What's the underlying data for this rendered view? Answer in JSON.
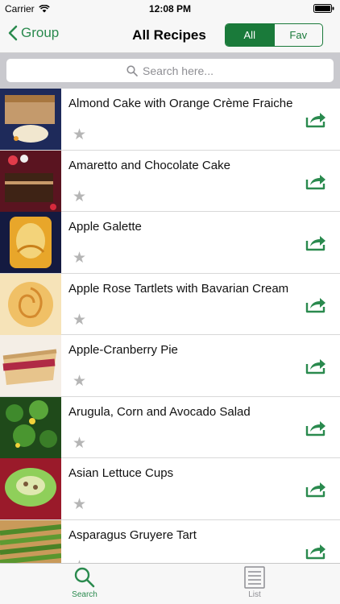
{
  "status": {
    "carrier": "Carrier",
    "time": "12:08 PM"
  },
  "nav": {
    "back_label": "Group",
    "title": "All Recipes",
    "segments": [
      "All",
      "Fav"
    ]
  },
  "search": {
    "placeholder": "Search here..."
  },
  "recipes": [
    {
      "title": "Almond Cake with Orange Crème Fraiche",
      "favorite": false
    },
    {
      "title": "Amaretto and Chocolate Cake",
      "favorite": false
    },
    {
      "title": "Apple Galette",
      "favorite": false
    },
    {
      "title": "Apple Rose Tartlets with Bavarian Cream",
      "favorite": false
    },
    {
      "title": "Apple-Cranberry Pie",
      "favorite": false
    },
    {
      "title": "Arugula, Corn and Avocado Salad",
      "favorite": false
    },
    {
      "title": "Asian Lettuce Cups",
      "favorite": false
    },
    {
      "title": "Asparagus Gruyere Tart",
      "favorite": false
    }
  ],
  "tabs": {
    "search_label": "Search",
    "list_label": "List"
  },
  "colors": {
    "accent": "#2a8a4e",
    "segment": "#1a7a3a",
    "star": "#b5b5b5"
  },
  "icons": {
    "share": "share-icon",
    "star": "star-icon",
    "search": "magnifier-icon",
    "list": "list-icon"
  }
}
